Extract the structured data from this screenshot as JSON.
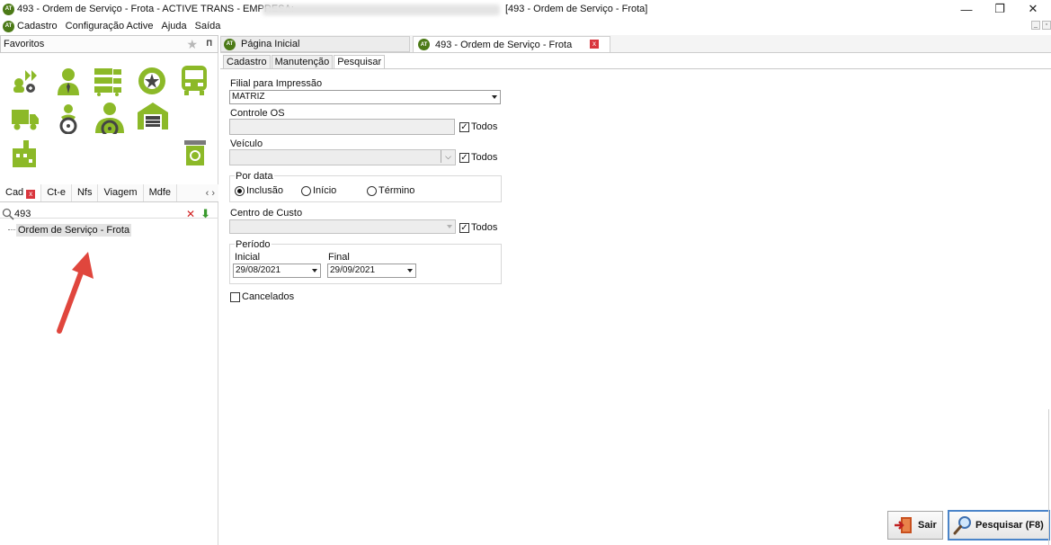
{
  "window": {
    "title": "493 - Ordem de Serviço - Frota - ACTIVE TRANS - EMPRESA:",
    "title_right": "[493 - Ordem de Serviço - Frota]",
    "logo_text": "AT",
    "controls": {
      "minimize": "—",
      "restore": "❐",
      "close": "✕"
    }
  },
  "menubar": {
    "items": [
      "Cadastro",
      "Configuração Active",
      "Ajuda",
      "Saída"
    ]
  },
  "favorites": {
    "label": "Favoritos"
  },
  "sidebar": {
    "icons": [
      "add-vehicle-icon",
      "person-icon",
      "fleet-icon",
      "tire-icon",
      "bus-icon",
      "truck-icon",
      "driver-icon",
      "steering-person-icon",
      "garage-icon",
      "factory-icon",
      "recycle-bin-icon"
    ],
    "tabs": [
      "Cad",
      "Ct-e",
      "Nfs",
      "Viagem",
      "Mdfe"
    ],
    "nav": "‹ ›",
    "search_value": "493",
    "tree": [
      "Ordem de Serviço - Frota"
    ]
  },
  "doc_tabs": [
    {
      "label": "Página Inicial"
    },
    {
      "label": "493 - Ordem de Serviço - Frota"
    }
  ],
  "inner_tabs": [
    "Cadastro",
    "Manutenção",
    "Pesquisar"
  ],
  "form": {
    "filial_label": "Filial para Impressão",
    "filial_value": "MATRIZ",
    "controle_label": "Controle OS",
    "veiculo_label": "Veículo",
    "todos": "Todos",
    "por_data_label": "Por data",
    "radio_options": [
      "Inclusão",
      "Início",
      "Término"
    ],
    "selected_radio": "Inclusão",
    "centro_label": "Centro de Custo",
    "periodo_label": "Período",
    "inicial_label": "Inicial",
    "inicial_value": "29/08/2021",
    "final_label": "Final",
    "final_value": "29/09/2021",
    "cancelados_label": "Cancelados",
    "check_mark": "✓"
  },
  "buttons": {
    "sair": "Sair",
    "pesquisar": "Pesquisar (F8)"
  },
  "colors": {
    "icon_green": "#8cb928",
    "accent_blue": "#4a84c9",
    "arrow_red": "#e0463d"
  }
}
